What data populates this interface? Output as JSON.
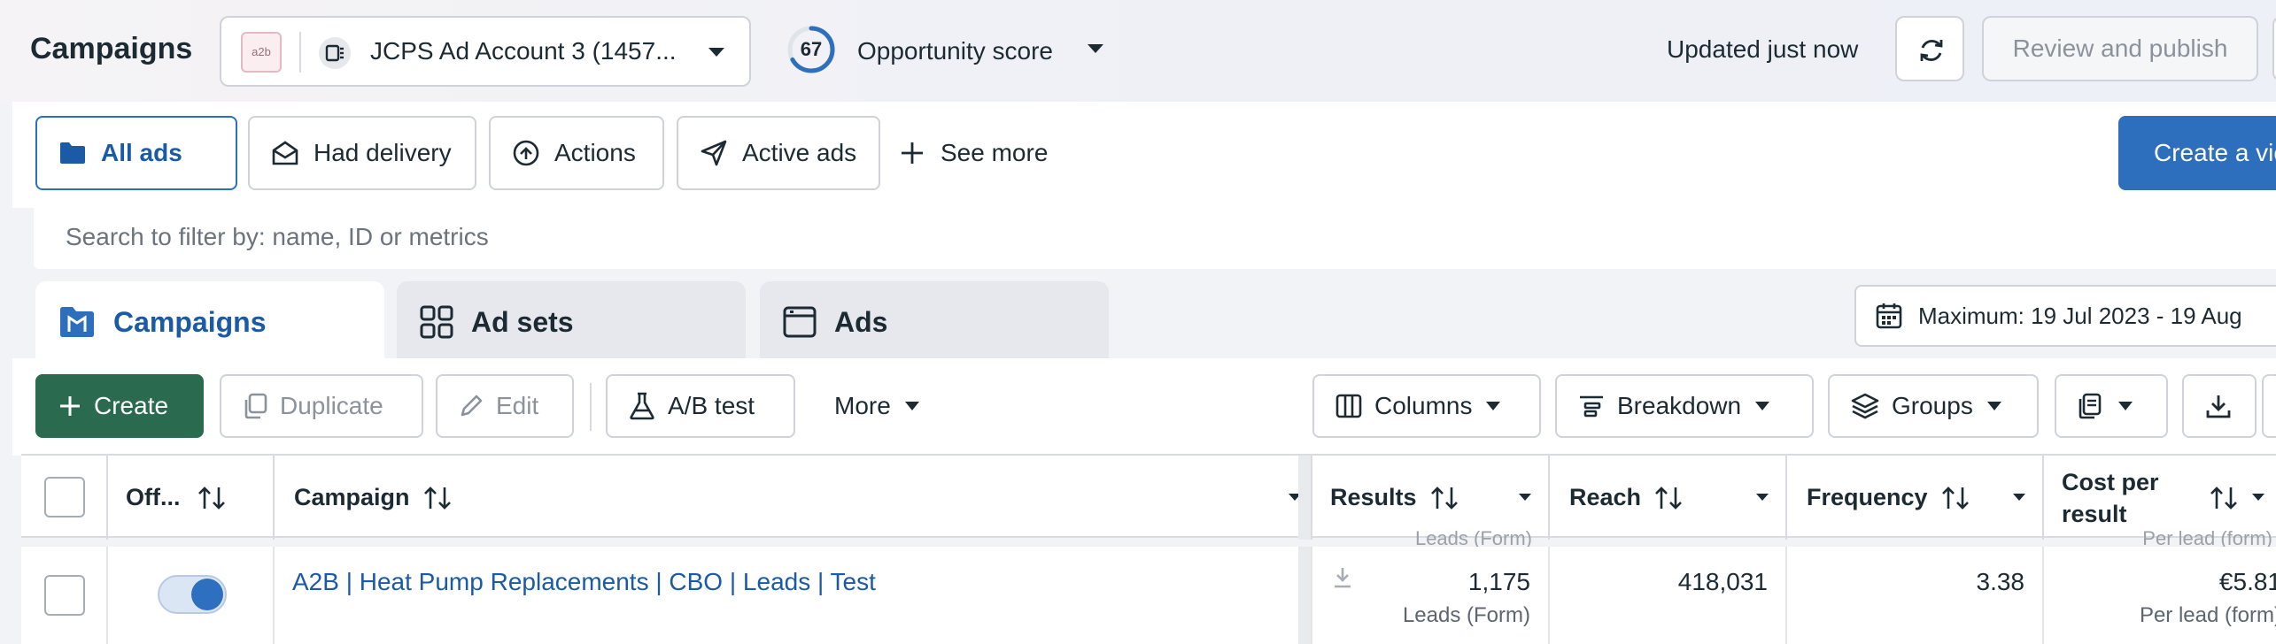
{
  "header": {
    "title": "Campaigns",
    "account_logo": "a2b",
    "account_name": "JCPS Ad Account 3 (1457...",
    "opportunity_score": "67",
    "opportunity_score_fraction": 0.67,
    "opportunity_label": "Opportunity score",
    "updated_text": "Updated just now",
    "review_label": "Review and publish"
  },
  "filters": {
    "pills": [
      {
        "label": "All ads",
        "icon": "folder-icon"
      },
      {
        "label": "Had delivery",
        "icon": "envelope-open-icon"
      },
      {
        "label": "Actions",
        "icon": "arrow-up-circle-icon"
      },
      {
        "label": "Active ads",
        "icon": "send-icon"
      }
    ],
    "see_more": "See more",
    "create_view": "Create a view"
  },
  "search": {
    "placeholder": "Search to filter by: name, ID or metrics"
  },
  "tabs": [
    {
      "label": "Campaigns",
      "icon": "folder-icon"
    },
    {
      "label": "Ad sets",
      "icon": "grid-icon"
    },
    {
      "label": "Ads",
      "icon": "ad-window-icon"
    }
  ],
  "date_range": "Maximum: 19 Jul 2023 - 19 Aug",
  "toolbar": {
    "create": "Create",
    "duplicate": "Duplicate",
    "edit": "Edit",
    "ab_test": "A/B test",
    "more": "More",
    "columns": "Columns",
    "breakdown": "Breakdown",
    "groups": "Groups"
  },
  "table": {
    "headers": {
      "offon": "Off...",
      "campaign": "Campaign",
      "results": "Results",
      "reach": "Reach",
      "frequency": "Frequency",
      "cost_line1": "Cost per",
      "cost_line2": "result"
    },
    "ghost": {
      "results": "Leads (Form)",
      "cost": "Per lead (form)"
    },
    "rows": [
      {
        "campaign": "A2B | Heat Pump Replacements | CBO | Leads | Test",
        "results": "1,175",
        "results_type": "Leads (Form)",
        "reach": "418,031",
        "frequency": "3.38",
        "cost": "€5.81",
        "cost_type": "Per lead (form)"
      }
    ]
  },
  "colors": {
    "accent": "#2d6fbd",
    "create": "#2a6b4f"
  }
}
